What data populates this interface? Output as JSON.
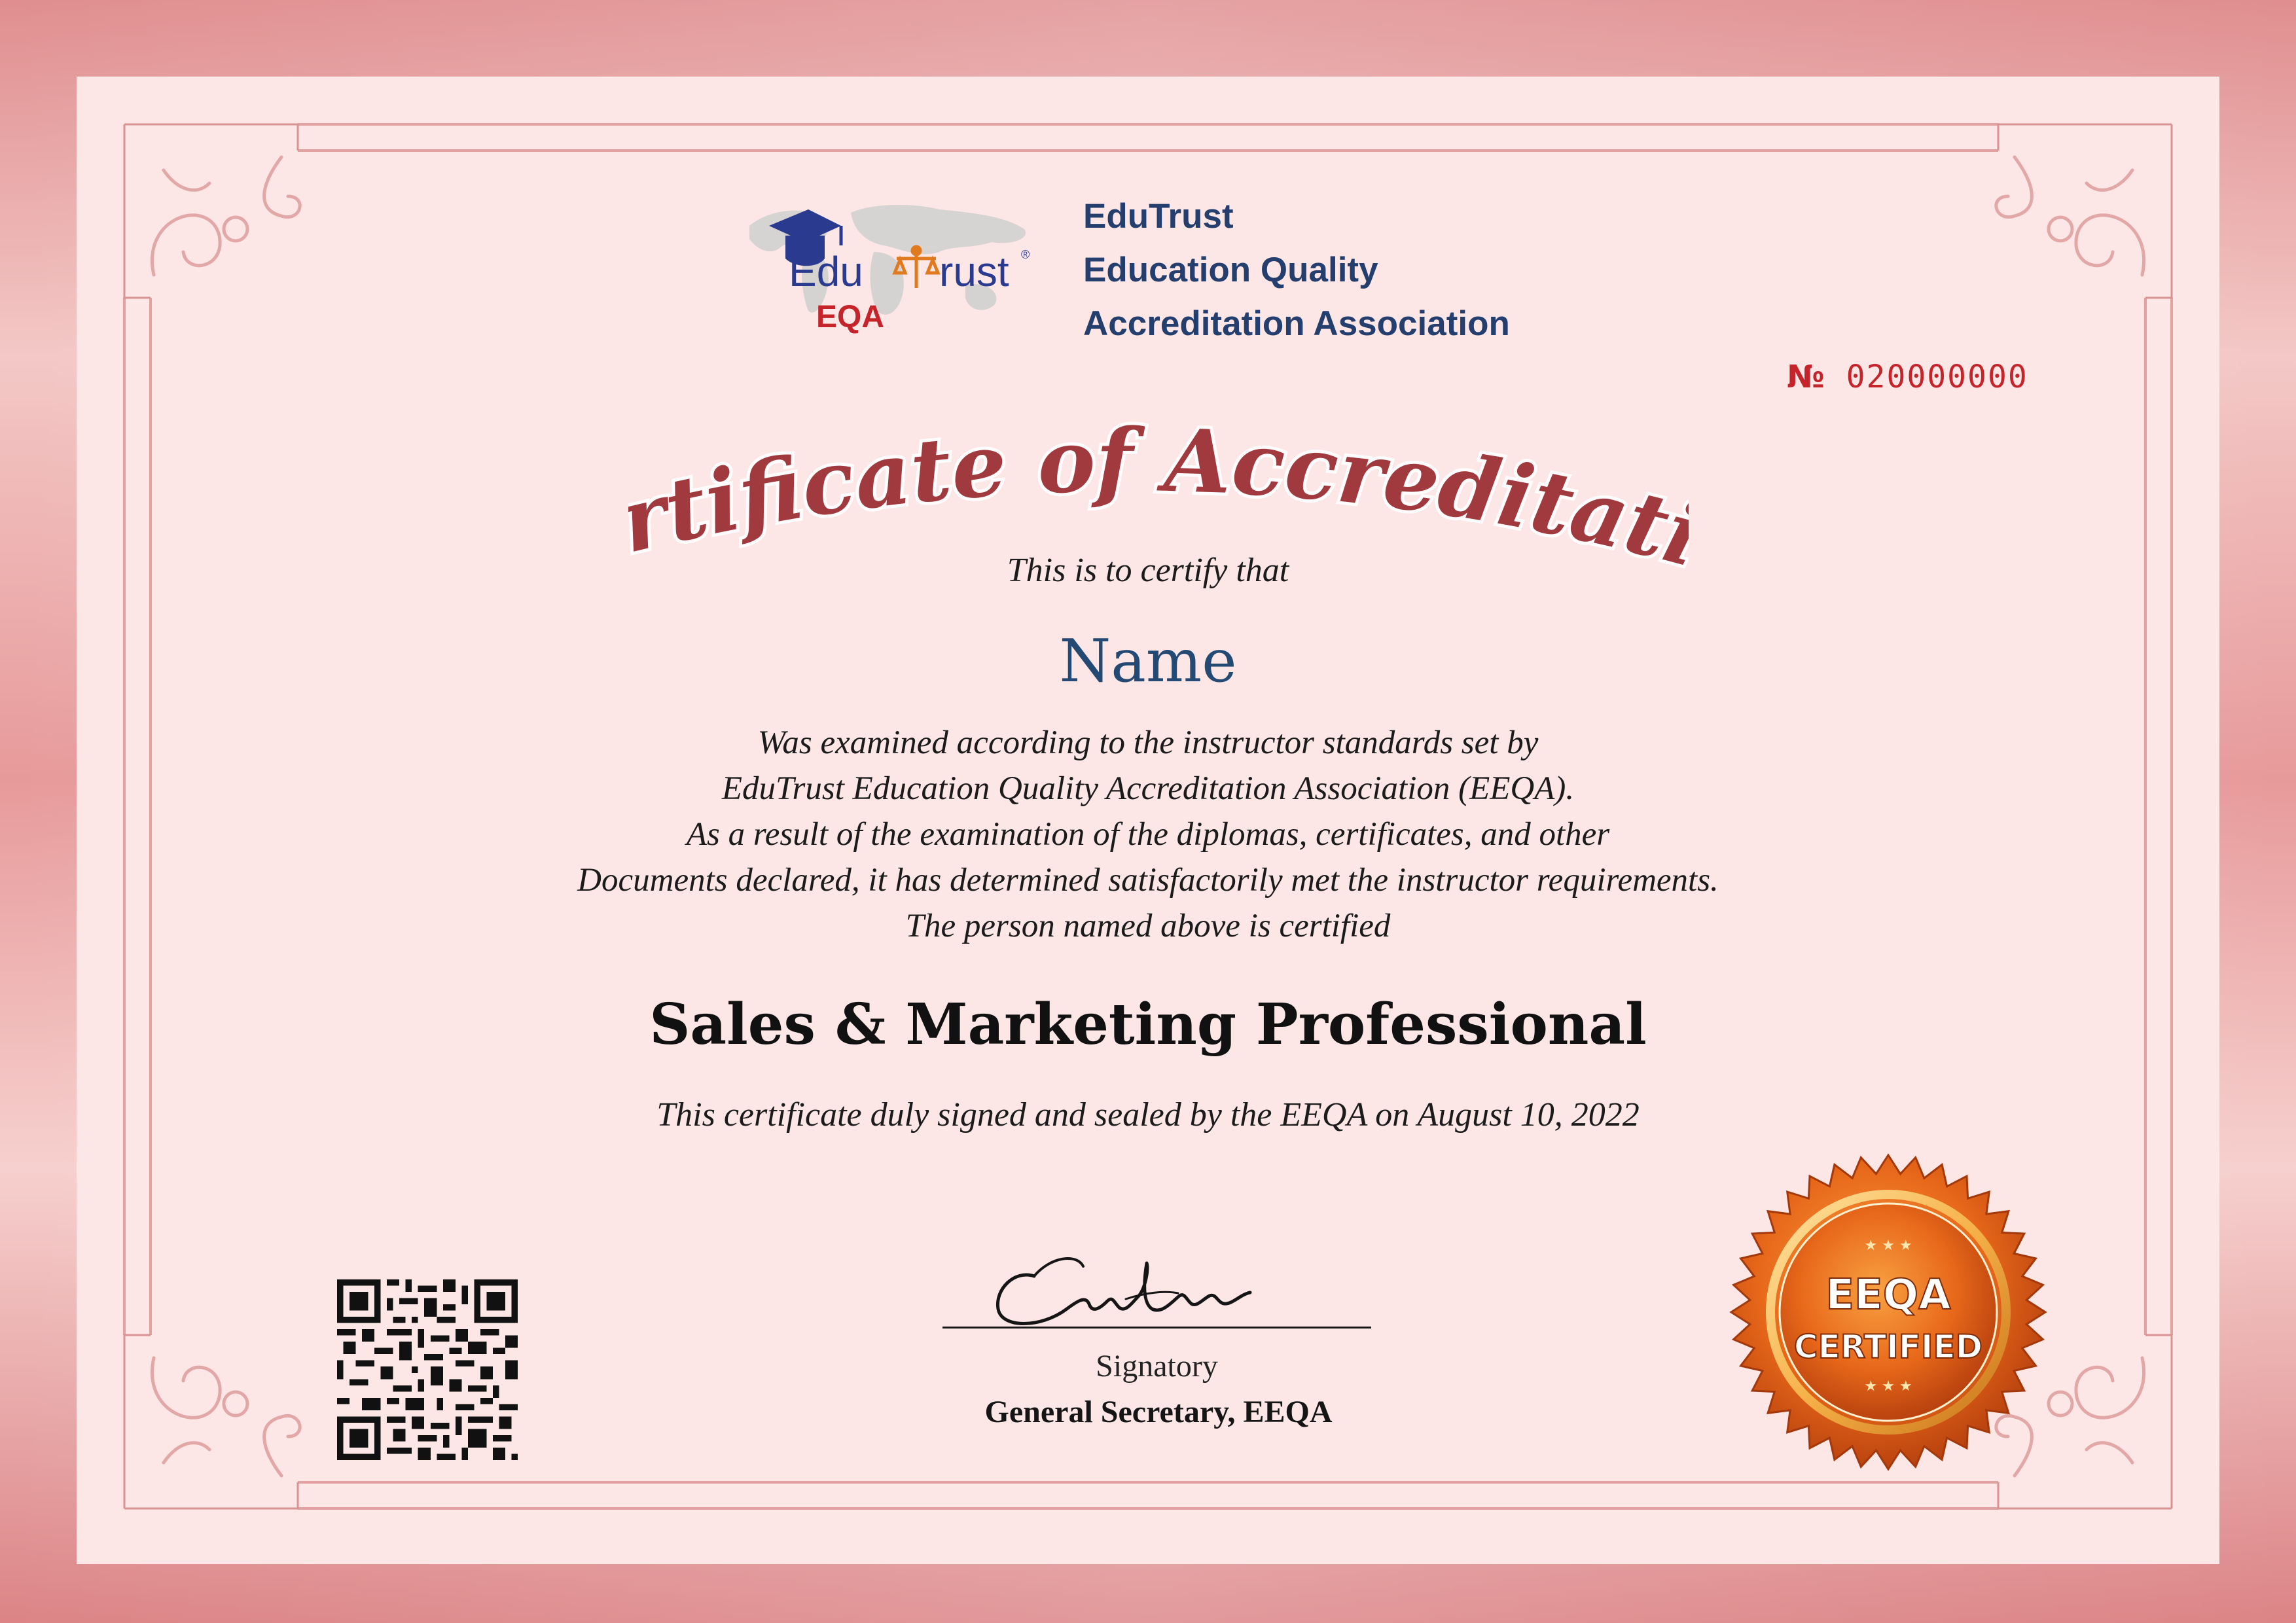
{
  "organization": {
    "logo_text_edu": "Edu",
    "logo_text_rust": "rust",
    "logo_text_sub": "EQA",
    "name_lines": [
      "EduTrust",
      "Education Quality",
      "Accreditation Association"
    ]
  },
  "certificate_number": {
    "sign": "№",
    "value": "020000000"
  },
  "title": "Certificate of Accreditation",
  "certify_that": "This is to certify that",
  "recipient_name": "Name",
  "body_lines": [
    "Was examined according to the instructor standards set by",
    "EduTrust Education Quality Accreditation Association (EEQA).",
    "As a result of the examination of the diplomas, certificates, and other",
    "Documents declared, it has determined satisfactorily met the instructor requirements.",
    "The person named above is  certified"
  ],
  "program": "Sales & Marketing Professional",
  "sealed_line": "This certificate duly signed and sealed by the EEQA on August 10, 2022",
  "signature": {
    "label": "Signatory",
    "title": "General Secretary, EEQA"
  },
  "seal": {
    "line1": "EEQA",
    "line2": "CERTIFIED"
  },
  "colors": {
    "border_pink": "#e08e8f",
    "paper": "#fce6e6",
    "title_red": "#a03a3e",
    "org_blue": "#243f6e",
    "name_blue": "#244a74",
    "number_red": "#c4242a",
    "seal_orange": "#e8681a"
  }
}
